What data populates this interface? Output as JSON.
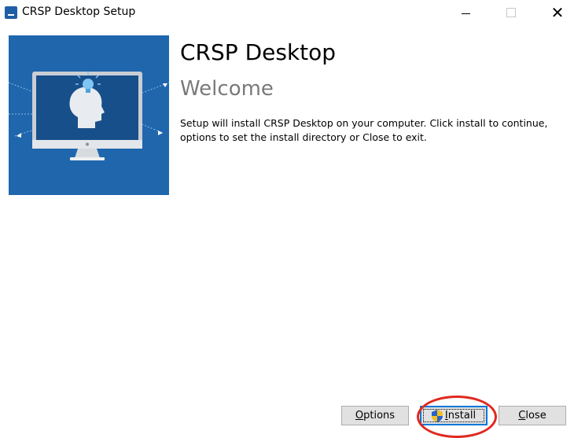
{
  "window": {
    "title": "CRSP Desktop Setup",
    "controls": {
      "minimize_glyph": "—",
      "maximize_glyph": "",
      "close_glyph": "✕"
    },
    "icon": "installer-icon"
  },
  "banner": {
    "icon": "monitor-head-lightbulb-illustration",
    "background": "#1f66ad"
  },
  "content": {
    "product_title": "CRSP Desktop",
    "welcome_heading": "Welcome",
    "description": "Setup will install CRSP Desktop on your computer. Click install to continue, options to set the install directory or Close to exit."
  },
  "buttons": {
    "options_label": "Options",
    "install_label": "Install",
    "close_label": "Close"
  },
  "annotation": {
    "color": "#e0291f",
    "target": "install-button"
  }
}
